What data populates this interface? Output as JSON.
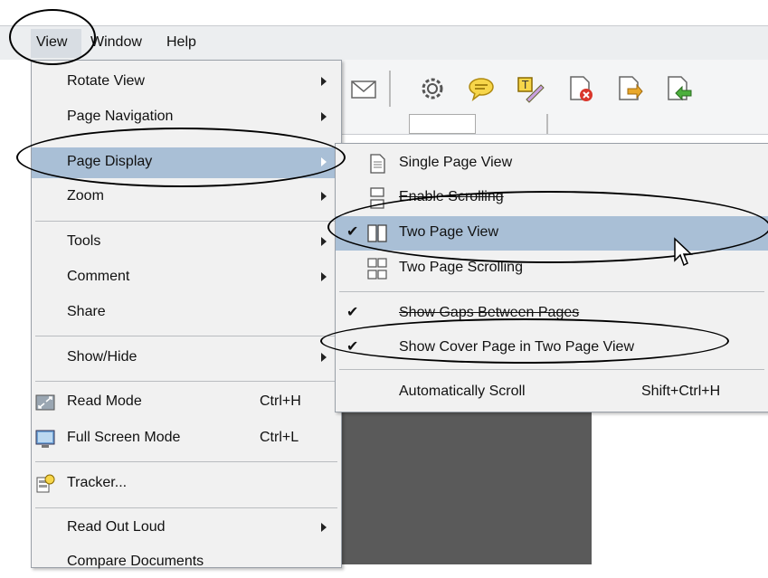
{
  "menubar": {
    "items": [
      "View",
      "Window",
      "Help"
    ]
  },
  "view_menu": {
    "items": [
      {
        "label": "Rotate View",
        "shortcut": "",
        "submenu": true
      },
      {
        "label": "Page Navigation",
        "shortcut": "",
        "submenu": true
      },
      {
        "label": "Page Display",
        "shortcut": "",
        "submenu": true,
        "highlighted": true
      },
      {
        "label": "Zoom",
        "shortcut": "",
        "submenu": true
      },
      {
        "label": "Tools",
        "shortcut": "",
        "submenu": true
      },
      {
        "label": "Comment",
        "shortcut": "",
        "submenu": true
      },
      {
        "label": "Share",
        "shortcut": "",
        "submenu": false
      },
      {
        "label": "Show/Hide",
        "shortcut": "",
        "submenu": true
      },
      {
        "label": "Read Mode",
        "shortcut": "Ctrl+H",
        "submenu": false,
        "icon": "read-mode-icon"
      },
      {
        "label": "Full Screen Mode",
        "shortcut": "Ctrl+L",
        "submenu": false,
        "icon": "full-screen-icon"
      },
      {
        "label": "Tracker...",
        "shortcut": "",
        "submenu": false,
        "icon": "tracker-icon"
      },
      {
        "label": "Read Out Loud",
        "shortcut": "",
        "submenu": true
      },
      {
        "label": "Compare Documents",
        "shortcut": "",
        "submenu": false
      }
    ]
  },
  "page_display_submenu": {
    "items": [
      {
        "label": "Single Page View",
        "checked": false,
        "icon": "single-page-icon"
      },
      {
        "label": "Enable Scrolling",
        "checked": false,
        "icon": "scrolling-icon"
      },
      {
        "label": "Two Page View",
        "checked": true,
        "icon": "two-page-icon",
        "highlighted": true
      },
      {
        "label": "Two Page Scrolling",
        "checked": false,
        "icon": "two-page-scrolling-icon"
      },
      {
        "label": "Show Gaps Between Pages",
        "checked": true
      },
      {
        "label": "Show Cover Page in Two Page View",
        "checked": true
      },
      {
        "label": "Automatically Scroll",
        "shortcut": "Shift+Ctrl+H",
        "checked": false
      }
    ]
  },
  "toolbar": {
    "icons": [
      "mail-icon",
      "gear-icon",
      "comment-bubble-icon",
      "highlight-note-icon",
      "delete-page-icon",
      "export-page-icon",
      "insert-page-icon"
    ]
  },
  "colors": {
    "highlight": "#a9bfd6",
    "menu_bg": "#f1f1f1",
    "dark_area": "#5a5a5a"
  }
}
